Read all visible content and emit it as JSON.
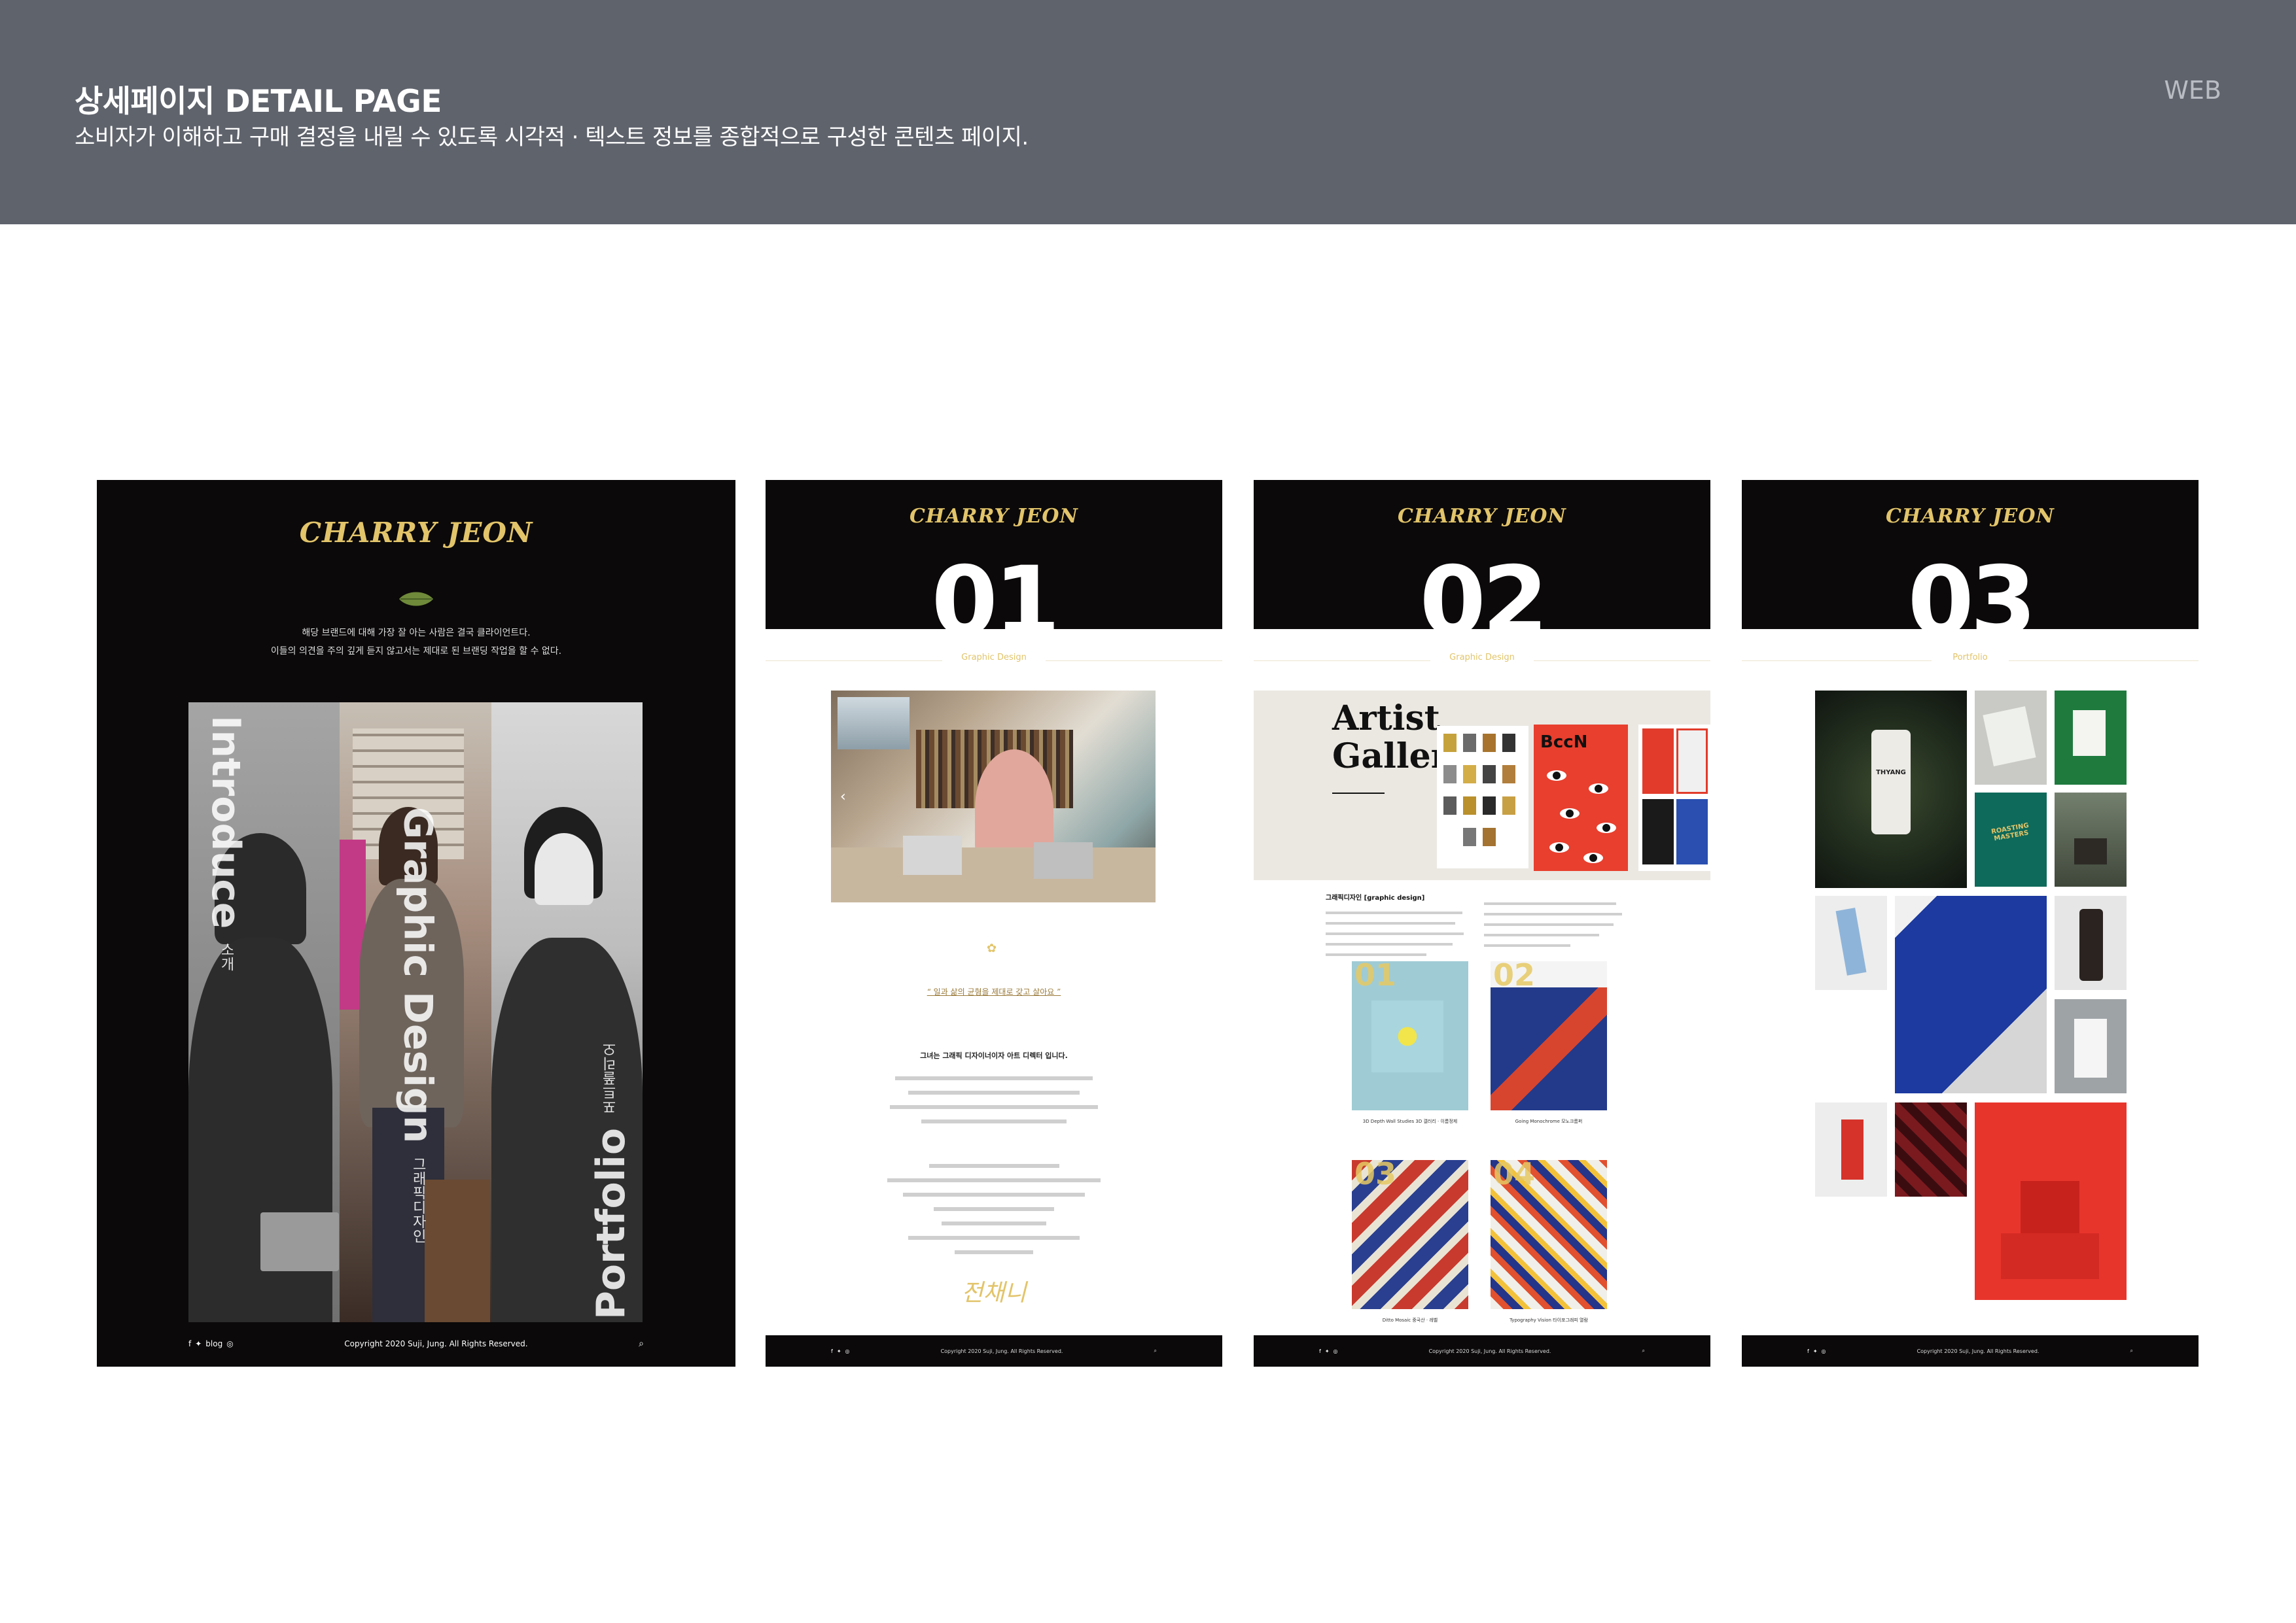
{
  "header": {
    "title": "상세페이지 DETAIL PAGE",
    "subtitle": "소비자가 이해하고 구매 결정을 내릴 수 있도록 시각적 · 텍스트 정보를 종합적으로 구성한 콘텐츠 페이지.",
    "tag": "WEB"
  },
  "brand": "CHARRY JEON",
  "panel1": {
    "intro_line1": "해당 브랜드에 대해 가장 잘 아는 사람은 결국 클라이언트다.",
    "intro_line2": "이들의 의견을 주의 깊게 듣지 않고서는 제대로 된 브랜딩 작업을 할 수 없다.",
    "strip1_en": "Introduce",
    "strip1_ko": "소개",
    "strip2_en": "Graphic Design",
    "strip2_ko": "그래픽디자인",
    "strip3_en": "Portfolio",
    "strip3_ko": "포트폴리오",
    "footer_blog": "blog",
    "footer_copy": "Copyright 2020 Suji, Jung. All Rights Reserved."
  },
  "panel2": {
    "number": "01",
    "section": "Graphic Design",
    "quote": "“ 일과 삶의 균형을 제대로 갖고 살아요 ”",
    "headline": "그녀는 그래픽 디자이너이자 아트 디렉터 입니다.",
    "signature": "전채니",
    "footer_copy": "Copyright 2020 Suji, Jung. All Rights Reserved."
  },
  "panel3": {
    "number": "02",
    "section": "Graphic Design",
    "banner_title": "Artist Gallery",
    "bccn": "BccN",
    "subhead": "그래픽디자인 [graphic design]",
    "works": [
      {
        "num": "01",
        "caption": "3D Depth Wall Studies 3D 갤러리 · 이름정제"
      },
      {
        "num": "02",
        "caption": "Going Monochrome 모노크롬퍼"
      },
      {
        "num": "03",
        "caption": "Ditto Mosaic 중국산 · 레벨"
      },
      {
        "num": "04",
        "caption": "Typography Vision 타이포그래피 열람"
      }
    ],
    "footer_copy": "Copyright 2020 Suji, Jung. All Rights Reserved."
  },
  "panel4": {
    "number": "03",
    "section": "Portfolio",
    "bottle_label": "THYANG",
    "box_label": "ROASTING MASTERS",
    "footer_copy": "Copyright 2020 Suji, Jung. All Rights Reserved."
  },
  "colors": {
    "header_bg": "#5f636c",
    "black": "#0b0909",
    "gold": "#e2c46a",
    "red": "#e8352c",
    "green": "#1f7a3e",
    "navy": "#1c3aa0"
  }
}
